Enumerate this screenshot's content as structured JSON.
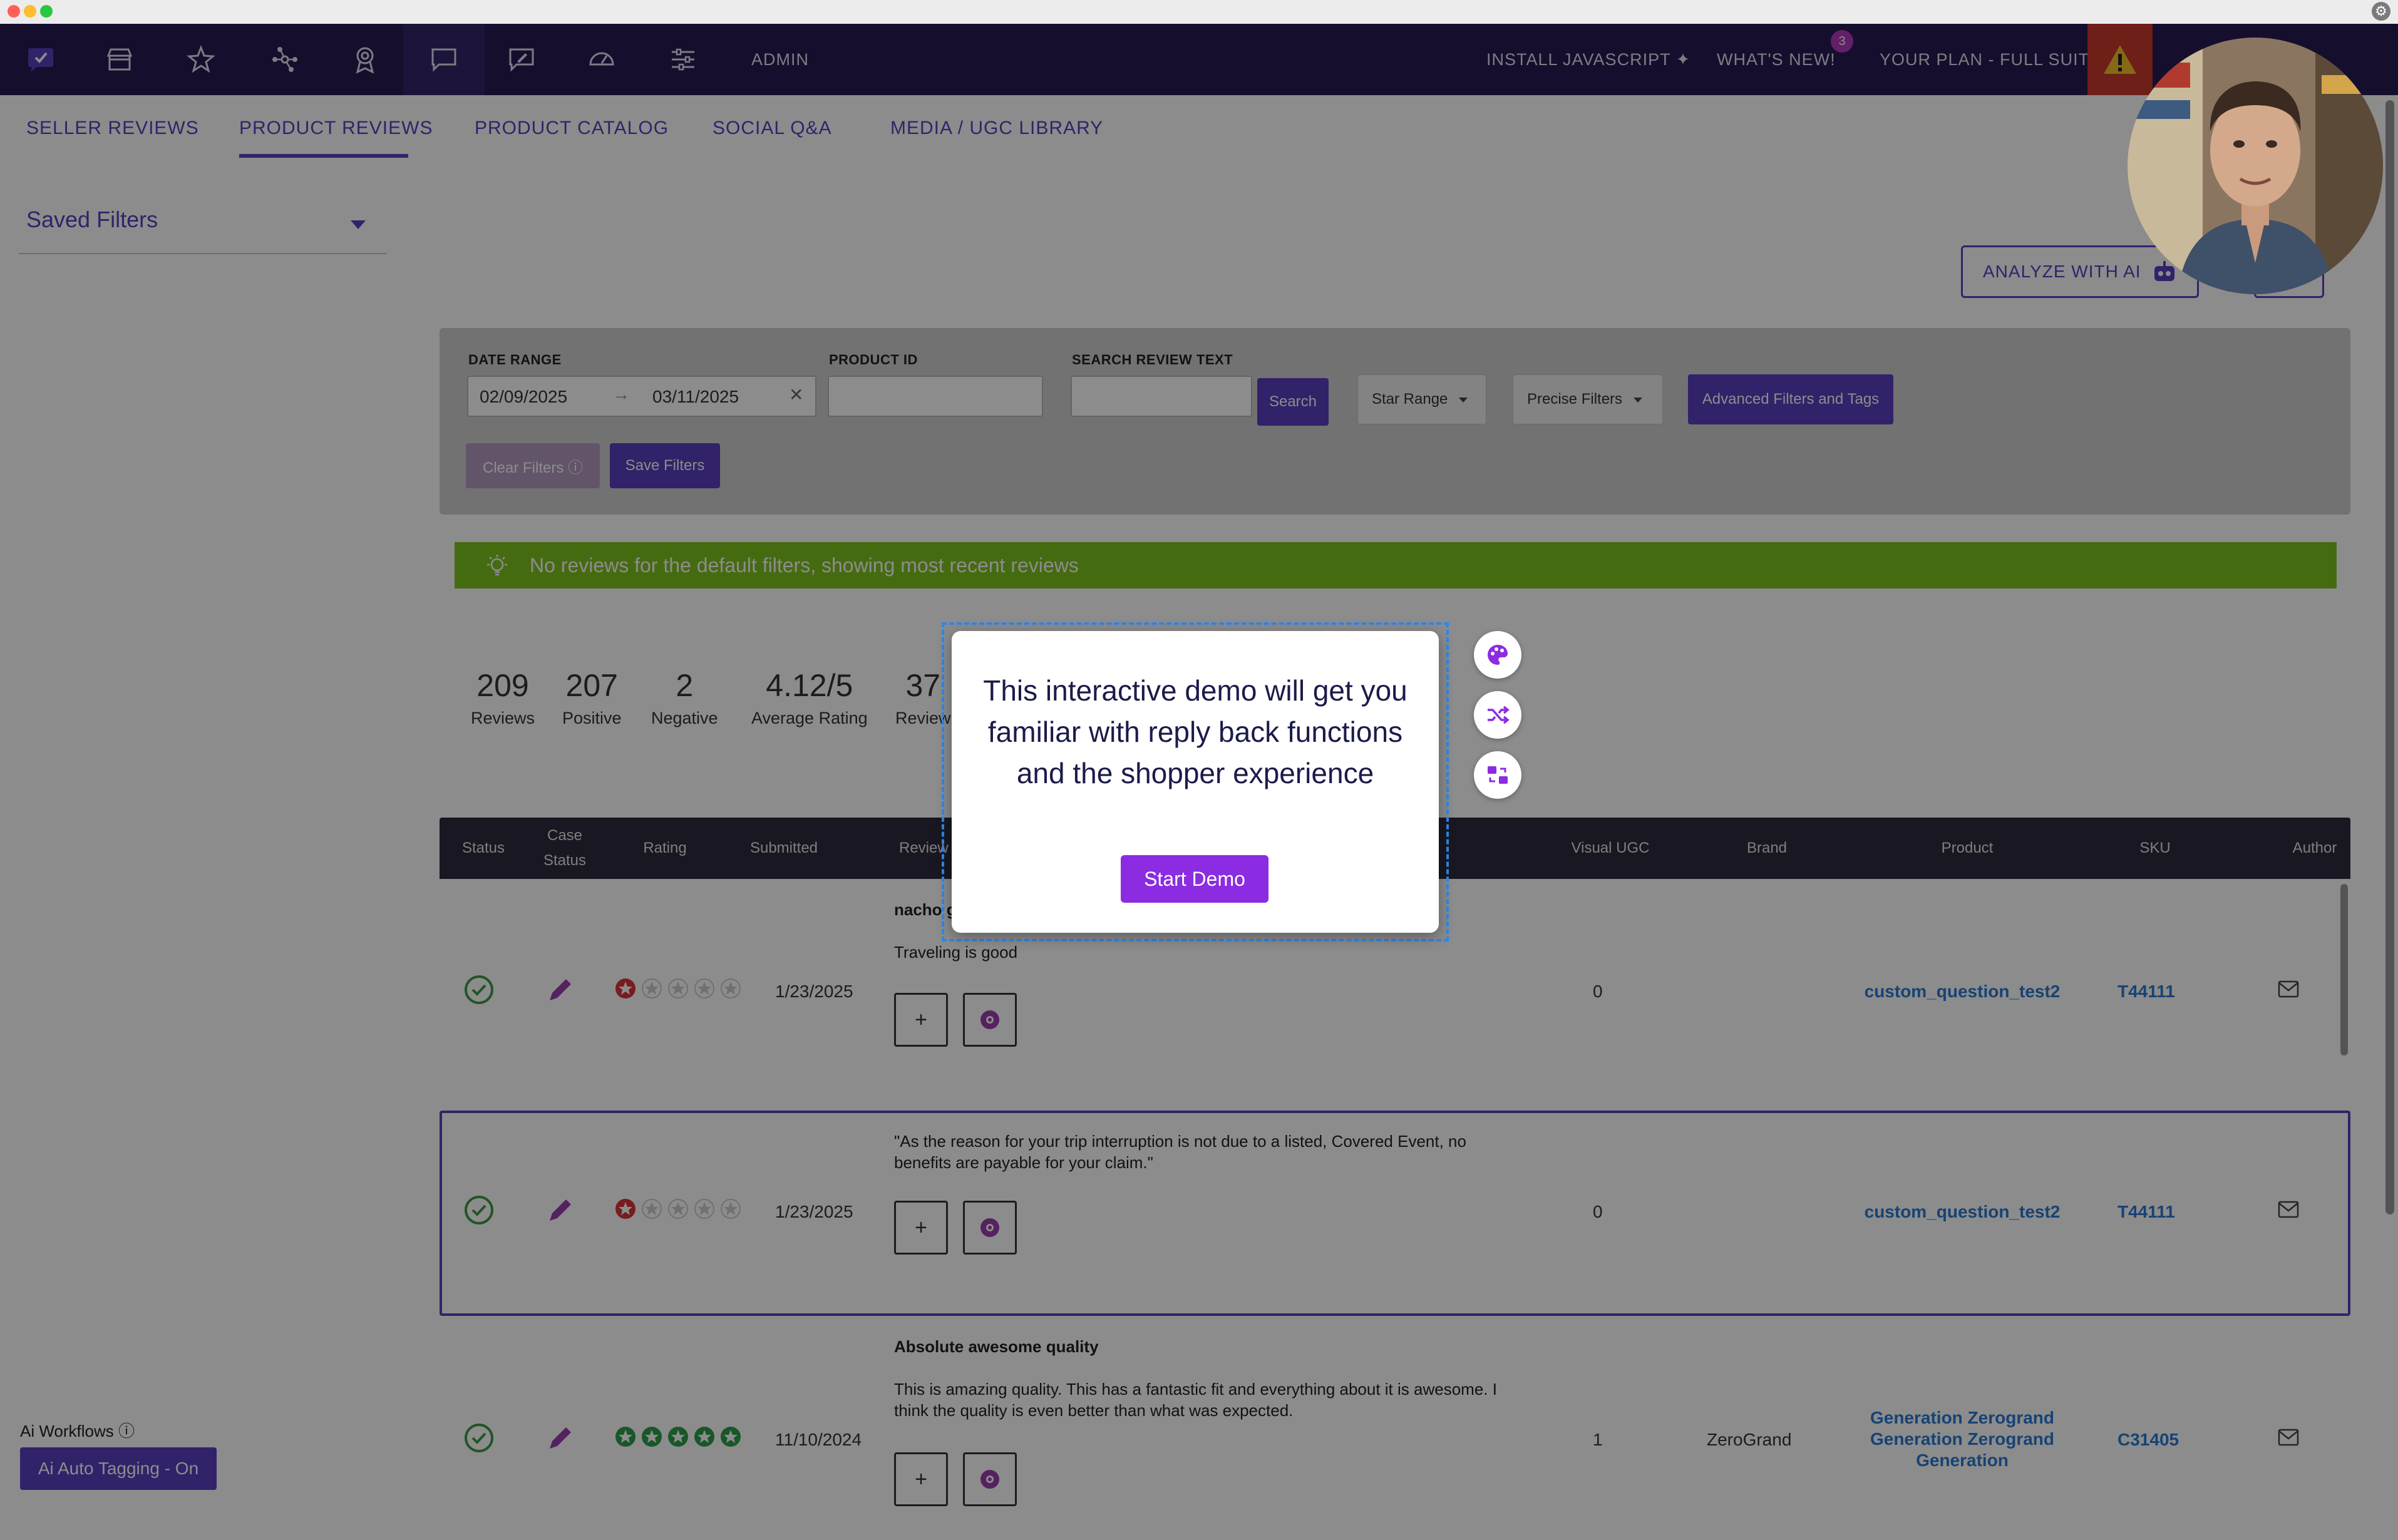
{
  "colors": {
    "nav_bg": "#281a52",
    "accent": "#5c3fbf",
    "banner": "#7ec320",
    "link": "#2a7bd4",
    "demo_button": "#8b2be2",
    "star_red": "#d9343a",
    "star_green": "#2e9e49"
  },
  "nav": {
    "icons": [
      "check-logo-icon",
      "store-icon",
      "star-icon",
      "network-icon",
      "award-icon",
      "chat-icon",
      "edit-note-icon",
      "speedometer-icon",
      "sliders-icon"
    ],
    "admin_label": "ADMIN",
    "install_js": "INSTALL JAVASCRIPT",
    "whats_new": "WHAT'S NEW!",
    "whats_new_count": "3",
    "plan": "YOUR PLAN - FULL SUITE"
  },
  "tabs": [
    "SELLER REVIEWS",
    "PRODUCT REVIEWS",
    "PRODUCT CATALOG",
    "SOCIAL Q&A",
    "MEDIA / UGC LIBRARY"
  ],
  "active_tab": "PRODUCT REVIEWS",
  "sidebar": {
    "saved_filters": "Saved Filters",
    "ai_workflows": "Ai Workflows",
    "ai_auto_tagging": "Ai Auto Tagging - On"
  },
  "analyze_button": "ANALYZE WITH AI",
  "filters": {
    "date_range_label": "DATE RANGE",
    "date_from": "02/09/2025",
    "date_to": "03/11/2025",
    "product_id_label": "PRODUCT ID",
    "product_id_value": "",
    "search_review_label": "SEARCH REVIEW TEXT",
    "search_review_value": "",
    "search_button": "Search",
    "star_range": "Star Range",
    "precise_filters": "Precise Filters",
    "advanced": "Advanced Filters and Tags",
    "clear": "Clear Filters",
    "save": "Save Filters"
  },
  "banner": "No reviews for the default filters, showing most recent reviews",
  "stats": [
    {
      "value": "209",
      "label": "Reviews"
    },
    {
      "value": "207",
      "label": "Positive"
    },
    {
      "value": "2",
      "label": "Negative"
    },
    {
      "value": "4.12/5",
      "label": "Average Rating"
    },
    {
      "value": "37",
      "label": "Review"
    }
  ],
  "table": {
    "headers": {
      "status": "Status",
      "case_status_1": "Case",
      "case_status_2": "Status",
      "rating": "Rating",
      "submitted": "Submitted",
      "review": "Review",
      "visual_ugc": "Visual UGC",
      "brand": "Brand",
      "product": "Product",
      "sku": "SKU",
      "author": "Author"
    },
    "rows": [
      {
        "title": "nacho g",
        "text": "Traveling is good",
        "rating": 1,
        "submitted": "1/23/2025",
        "visual_ugc": "0",
        "brand": "",
        "product": "custom_question_test2",
        "sku": "T44111"
      },
      {
        "title": "",
        "text": "\"As the reason for your trip interruption is not due to a listed, Covered Event, no benefits are payable for your claim.\"",
        "rating": 1,
        "submitted": "1/23/2025",
        "visual_ugc": "0",
        "brand": "",
        "product": "custom_question_test2",
        "sku": "T44111"
      },
      {
        "title": "Absolute awesome quality",
        "text": "This is amazing quality. This has a fantastic fit and everything about it is awesome. I think the quality is even better than what was expected.",
        "rating": 5,
        "submitted": "11/10/2024",
        "visual_ugc": "1",
        "brand": "ZeroGrand",
        "product": "Generation Zerogrand Generation Zerogrand Generation",
        "sku": "C31405"
      }
    ],
    "add_symbol": "+"
  },
  "demo": {
    "message": "This interactive demo will get you familiar with reply back functions and the shopper experience",
    "start_button": "Start Demo",
    "side_icons": [
      "palette-icon",
      "shuffle-icon",
      "swap-icon"
    ]
  }
}
